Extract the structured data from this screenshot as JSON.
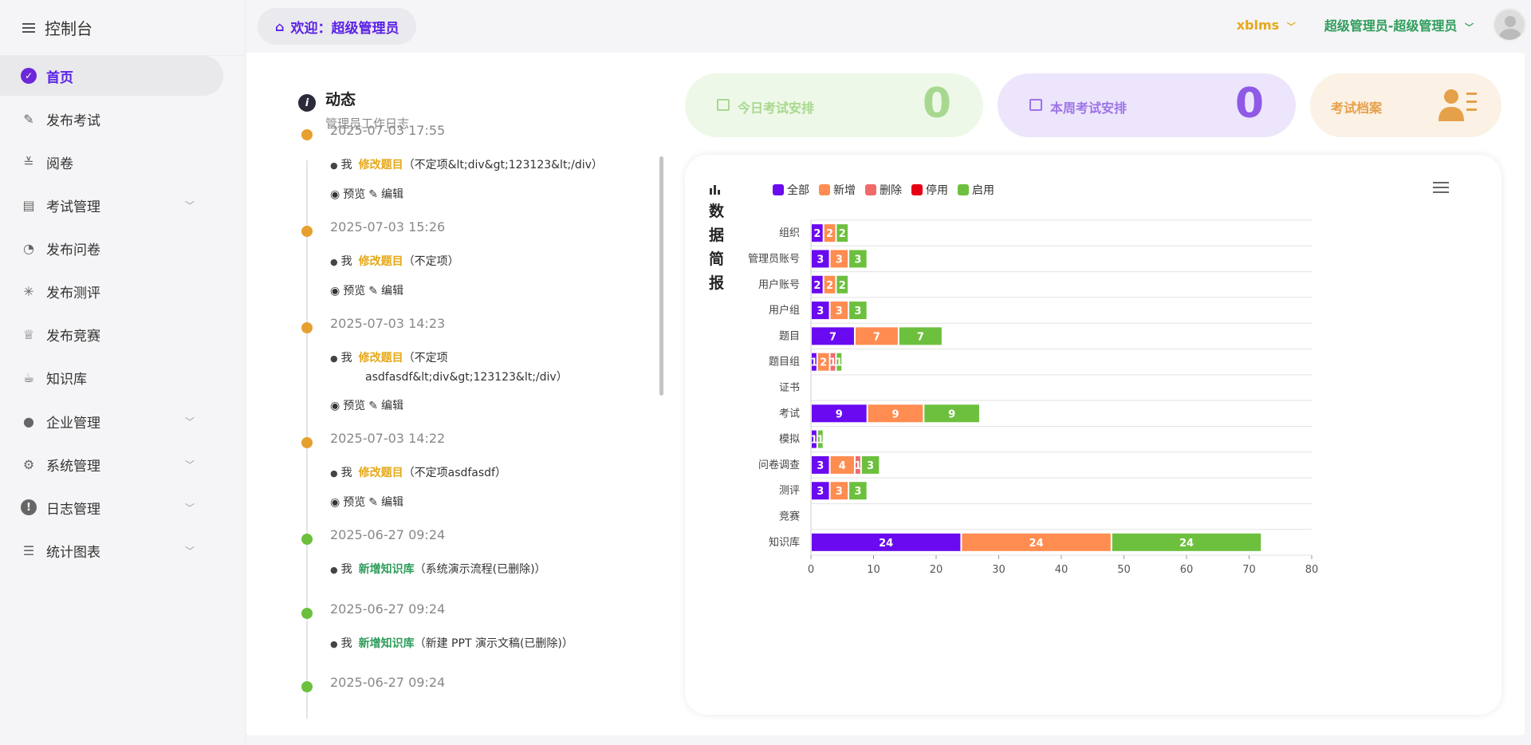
{
  "sidebar": {
    "title": "控制台",
    "items": [
      {
        "label": "首页",
        "icon": "check-circle-icon",
        "active": true,
        "chevron": false
      },
      {
        "label": "发布考试",
        "icon": "publish-exam-icon",
        "chevron": false
      },
      {
        "label": "阅卷",
        "icon": "grading-icon",
        "chevron": false
      },
      {
        "label": "考试管理",
        "icon": "clipboard-icon",
        "chevron": true
      },
      {
        "label": "发布问卷",
        "icon": "survey-icon",
        "chevron": false
      },
      {
        "label": "发布测评",
        "icon": "loading-icon",
        "chevron": false
      },
      {
        "label": "发布竞赛",
        "icon": "trophy-icon",
        "chevron": false
      },
      {
        "label": "知识库",
        "icon": "coffee-icon",
        "chevron": false
      },
      {
        "label": "企业管理",
        "icon": "user-icon",
        "chevron": true
      },
      {
        "label": "系统管理",
        "icon": "gear-icon",
        "chevron": true
      },
      {
        "label": "日志管理",
        "icon": "warning-icon",
        "chevron": true
      },
      {
        "label": "统计图表",
        "icon": "sliders-icon",
        "chevron": true
      }
    ]
  },
  "topbar": {
    "welcome": "欢迎：超级管理员",
    "site": "xblms",
    "user": "超级管理员-超级管理员"
  },
  "timeline": {
    "title": "动态",
    "subtitle": "管理员工作日志",
    "me": "我",
    "preview": "预览",
    "edit": "编辑",
    "entries": [
      {
        "time": "2025-07-03 17:55",
        "action": "修改题目",
        "color": "#e6a817",
        "content": "（不定项&lt;div&gt;123123&lt;/div）",
        "ops": true
      },
      {
        "time": "2025-07-03 15:26",
        "action": "修改题目",
        "color": "#e6a817",
        "content": "（不定项）",
        "ops": true
      },
      {
        "time": "2025-07-03 14:23",
        "action": "修改题目",
        "color": "#e6a817",
        "content": "（不定项",
        "content2": "asdfasdf&lt;div&gt;123123&lt;/div）",
        "ops": true
      },
      {
        "time": "2025-07-03 14:22",
        "action": "修改题目",
        "color": "#e6a817",
        "content": "（不定项asdfasdf）",
        "ops": true
      },
      {
        "time": "2025-06-27 09:24",
        "action": "新增知识库",
        "color": "#2e9d5a",
        "content": "（系统演示流程(已删除)）",
        "ops": false
      },
      {
        "time": "2025-06-27 09:24",
        "action": "新增知识库",
        "color": "#2e9d5a",
        "content": "（新建 PPT 演示文稿(已删除)）",
        "ops": false
      },
      {
        "time": "2025-06-27 09:24",
        "action": "",
        "color": "#2e9d5a",
        "content": "",
        "ops": false
      }
    ]
  },
  "cards": {
    "today": {
      "label": "今日考试安排",
      "value": "0"
    },
    "week": {
      "label": "本周考试安排",
      "value": "0"
    },
    "archive": {
      "label": "考试档案"
    }
  },
  "chart_title": "数据简报",
  "chart_data": {
    "type": "bar",
    "orientation": "horizontal",
    "stacked": true,
    "categories": [
      "组织",
      "管理员账号",
      "用户账号",
      "用户组",
      "题目",
      "题目组",
      "证书",
      "考试",
      "模拟",
      "问卷调查",
      "测评",
      "竞赛",
      "知识库"
    ],
    "series": [
      {
        "name": "全部",
        "color": "#6a0af0",
        "values": [
          2,
          3,
          2,
          3,
          7,
          1,
          0,
          9,
          1,
          3,
          3,
          0,
          24
        ]
      },
      {
        "name": "新增",
        "color": "#ff8c50",
        "values": [
          2,
          3,
          2,
          3,
          7,
          2,
          0,
          9,
          0,
          4,
          3,
          0,
          24
        ]
      },
      {
        "name": "删除",
        "color": "#f06a6a",
        "values": [
          0,
          0,
          0,
          0,
          0,
          1,
          0,
          0,
          0,
          1,
          0,
          0,
          0
        ]
      },
      {
        "name": "停用",
        "color": "#e60012",
        "values": [
          0,
          0,
          0,
          0,
          0,
          0,
          0,
          0,
          0,
          0,
          0,
          0,
          0
        ]
      },
      {
        "name": "启用",
        "color": "#6cc03e",
        "values": [
          2,
          3,
          2,
          3,
          7,
          1,
          0,
          9,
          1,
          3,
          3,
          0,
          24
        ]
      }
    ],
    "xlim": [
      0,
      80
    ],
    "xticks": [
      0,
      10,
      20,
      30,
      40,
      50,
      60,
      70,
      80
    ],
    "legend_position": "top-left"
  }
}
